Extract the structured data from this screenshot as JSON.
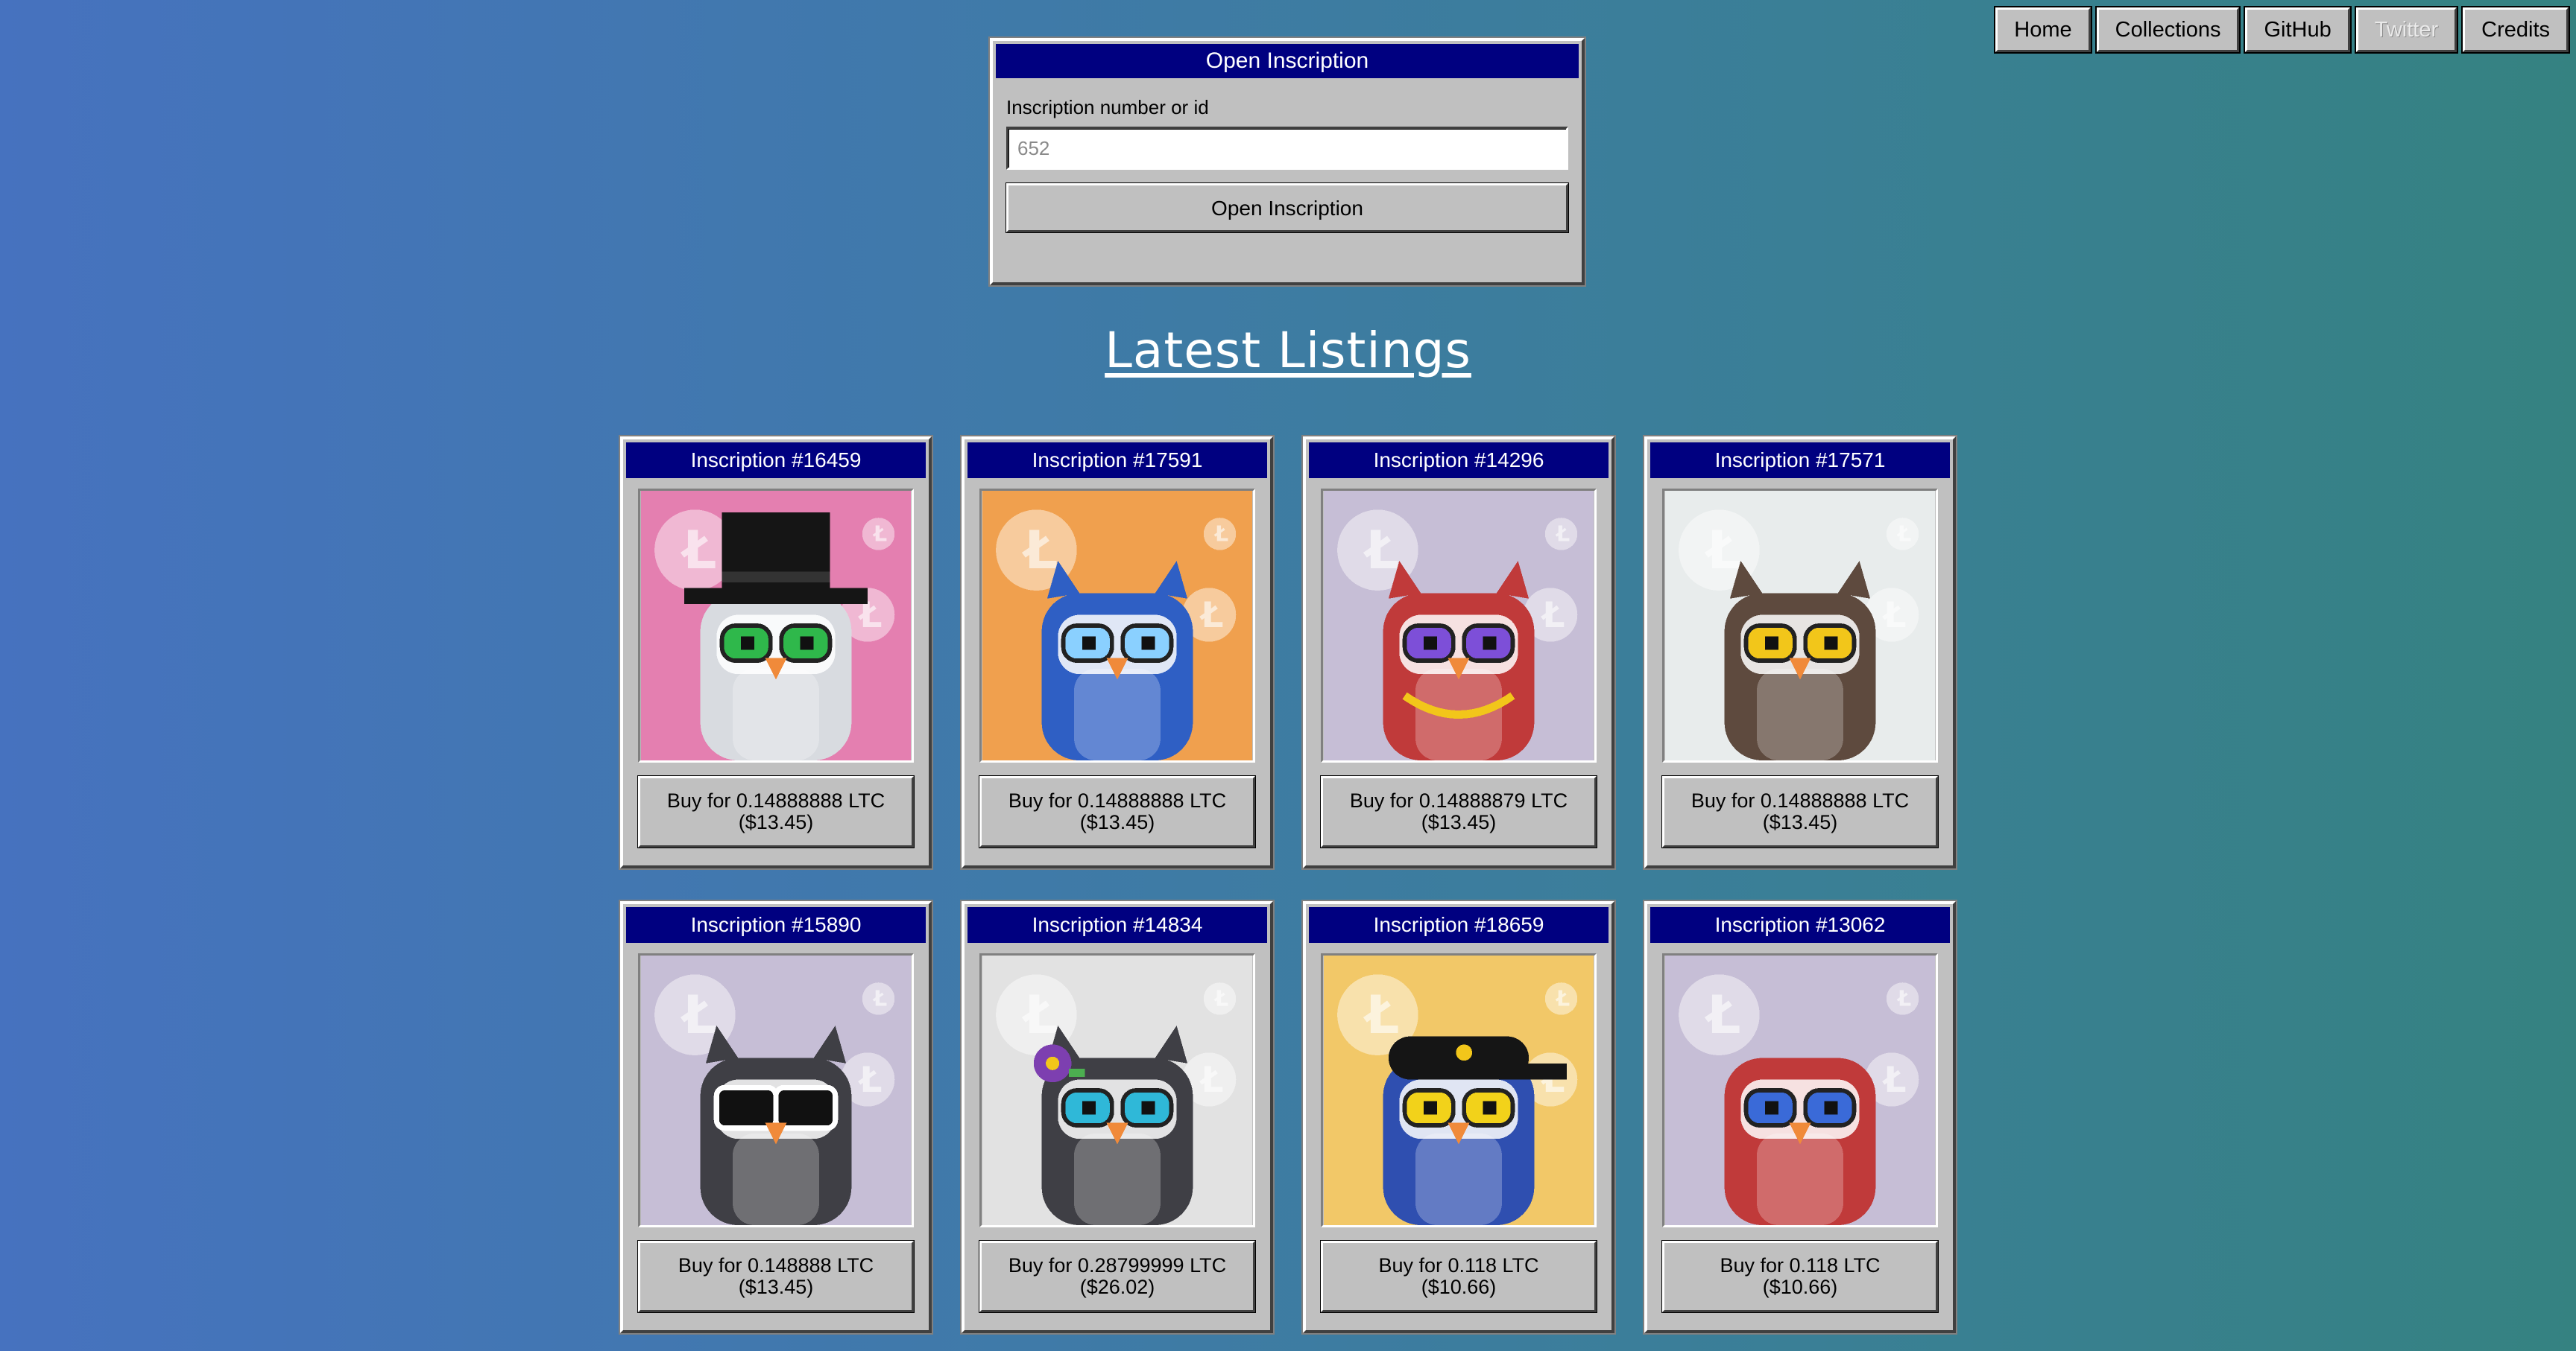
{
  "nav": [
    {
      "label": "Home",
      "disabled": false
    },
    {
      "label": "Collections",
      "disabled": false
    },
    {
      "label": "GitHub",
      "disabled": false
    },
    {
      "label": "Twitter",
      "disabled": true
    },
    {
      "label": "Credits",
      "disabled": false
    }
  ],
  "open_inscription": {
    "title": "Open Inscription",
    "field_label": "Inscription number or id",
    "placeholder": "652",
    "value": "",
    "button_label": "Open Inscription"
  },
  "heading": "Latest Listings",
  "listings": [
    {
      "title": "Inscription #16459",
      "buy_label": "Buy for 0.14888888 LTC ($13.45)",
      "bg": "#e47fb0",
      "body": "#d8dbe0",
      "accessory": "top-hat",
      "eyes": "#2fb84b"
    },
    {
      "title": "Inscription #17591",
      "buy_label": "Buy for 0.14888888 LTC ($13.45)",
      "bg": "#f0a04e",
      "body": "#2f5fc4",
      "accessory": "ears",
      "eyes": "#8ad0ff"
    },
    {
      "title": "Inscription #14296",
      "buy_label": "Buy for 0.14888879 LTC ($13.45)",
      "bg": "#c6bed6",
      "body": "#c03a3a",
      "accessory": "chain",
      "eyes": "#7d4fd8"
    },
    {
      "title": "Inscription #17571",
      "buy_label": "Buy for 0.14888888 LTC ($13.45)",
      "bg": "#e8ecec",
      "body": "#5e4a3e",
      "accessory": "ears",
      "eyes": "#f2c61a"
    },
    {
      "title": "Inscription #15890",
      "buy_label": "Buy for 0.148888 LTC ($13.45)",
      "bg": "#c6bed6",
      "body": "#3f3f45",
      "accessory": "shades",
      "eyes": "#ffffff"
    },
    {
      "title": "Inscription #14834",
      "buy_label": "Buy for 0.28799999 LTC ($26.02)",
      "bg": "#e2e2e2",
      "body": "#3f3f45",
      "accessory": "flower",
      "eyes": "#2fb8d8"
    },
    {
      "title": "Inscription #18659",
      "buy_label": "Buy for 0.118 LTC ($10.66)",
      "bg": "#f2c868",
      "body": "#2f4fb0",
      "accessory": "cap",
      "eyes": "#f2d21a"
    },
    {
      "title": "Inscription #13062",
      "buy_label": "Buy for 0.118 LTC ($10.66)",
      "bg": "#c6bed6",
      "body": "#c03a3a",
      "accessory": "none",
      "eyes": "#3a6ad8"
    }
  ]
}
